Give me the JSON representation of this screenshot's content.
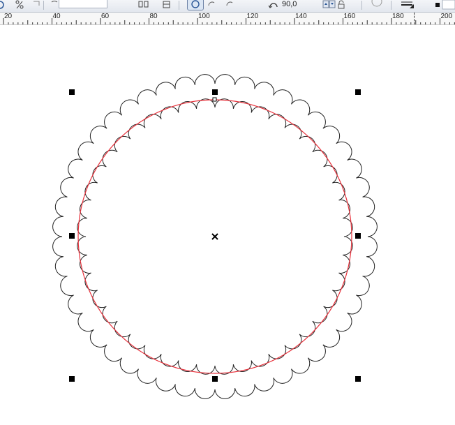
{
  "toolbar": {
    "rotation_value": "90,0",
    "icons": [
      "percent-icon",
      "pie-icon",
      "arc-icon",
      "rotation-icon",
      "spinner-icon",
      "lock-icon",
      "outline-icon",
      "fill-icon"
    ]
  },
  "ruler": {
    "labels": [
      "20",
      "40",
      "60",
      "80",
      "100",
      "120",
      "140",
      "160",
      "180",
      "200"
    ]
  },
  "colors": {
    "guide_circle": "#e8323c",
    "scallop_outline": "#222222",
    "handle": "#000000"
  }
}
